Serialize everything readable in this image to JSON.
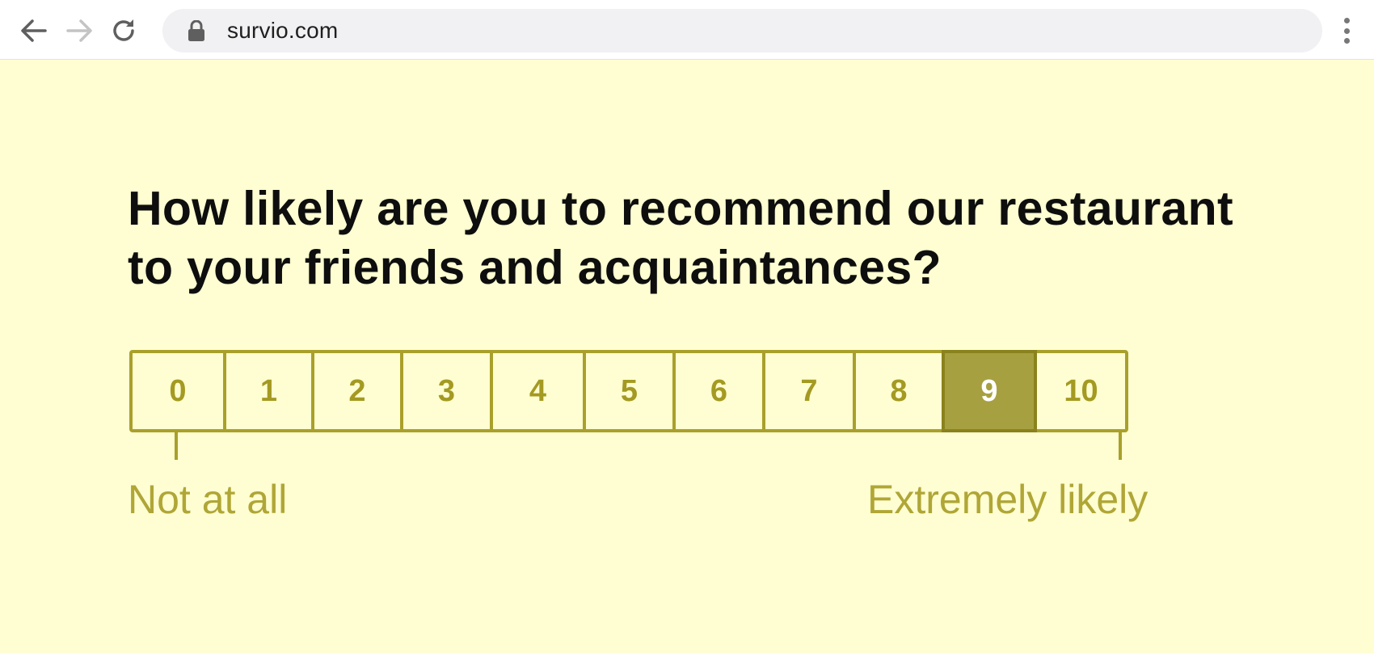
{
  "browser": {
    "url": "survio.com",
    "back_icon": "arrow-left",
    "forward_icon": "arrow-right",
    "reload_icon": "reload",
    "lock_icon": "padlock",
    "menu_icon": "vertical-dots"
  },
  "colors": {
    "page_background": "#fefed2",
    "accent": "#a9a02b",
    "selected_fill": "#a7a041",
    "question_text": "#0e0e0e"
  },
  "survey": {
    "question": "How likely are you to recommend our restaurant to your friends and acquaintances?",
    "scale": [
      {
        "label": "0"
      },
      {
        "label": "1"
      },
      {
        "label": "2"
      },
      {
        "label": "3"
      },
      {
        "label": "4"
      },
      {
        "label": "5"
      },
      {
        "label": "6"
      },
      {
        "label": "7"
      },
      {
        "label": "8"
      },
      {
        "label": "9"
      },
      {
        "label": "10"
      }
    ],
    "selected_value": "9",
    "low_label": "Not at all",
    "high_label": "Extremely likely"
  }
}
